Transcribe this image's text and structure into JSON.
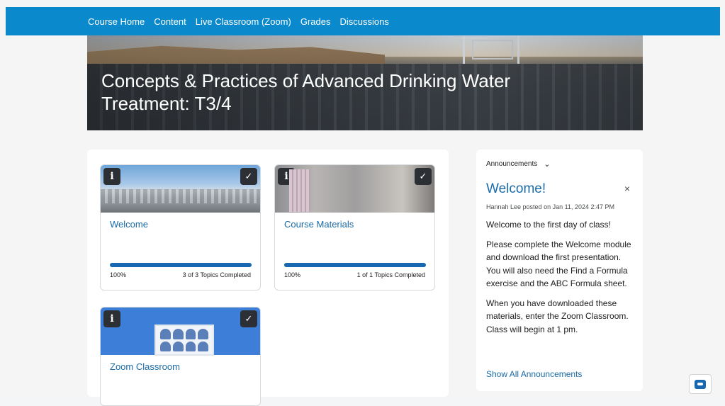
{
  "nav": {
    "items": [
      "Course Home",
      "Content",
      "Live Classroom (Zoom)",
      "Grades",
      "Discussions"
    ]
  },
  "banner": {
    "title": "Concepts & Practices of Advanced Drinking Water Treatment: T3/4"
  },
  "modules": [
    {
      "title": "Welcome",
      "percent": "100%",
      "completed": "3 of 3 Topics Completed",
      "progress": 1.0,
      "image": "water-treatment-plant-photo"
    },
    {
      "title": "Course Materials",
      "percent": "100%",
      "completed": "1 of 1 Topics Completed",
      "progress": 1.0,
      "image": "desk-stationery-photo"
    },
    {
      "title": "Zoom Classroom",
      "image": "video-conference-illustration"
    }
  ],
  "announcements": {
    "header": "Announcements",
    "title": "Welcome!",
    "meta": "Hannah Lee posted on Jan 11, 2024 2:47 PM",
    "paragraphs": [
      "Welcome to the first day of class!",
      "Please complete the Welcome module and download the first presentation. You will also need the Find a Formula exercise and the ABC Formula sheet.",
      "When you have downloaded these materials, enter the Zoom Classroom. Class will begin at 1 pm."
    ],
    "show_all": "Show All Announcements"
  },
  "icons": {
    "info": "i",
    "check": "✓",
    "chevron": "⌄",
    "close": "×"
  },
  "colors": {
    "nav_bg": "#0a8acc",
    "link": "#1a6ba8",
    "progress": "#1768b0"
  }
}
